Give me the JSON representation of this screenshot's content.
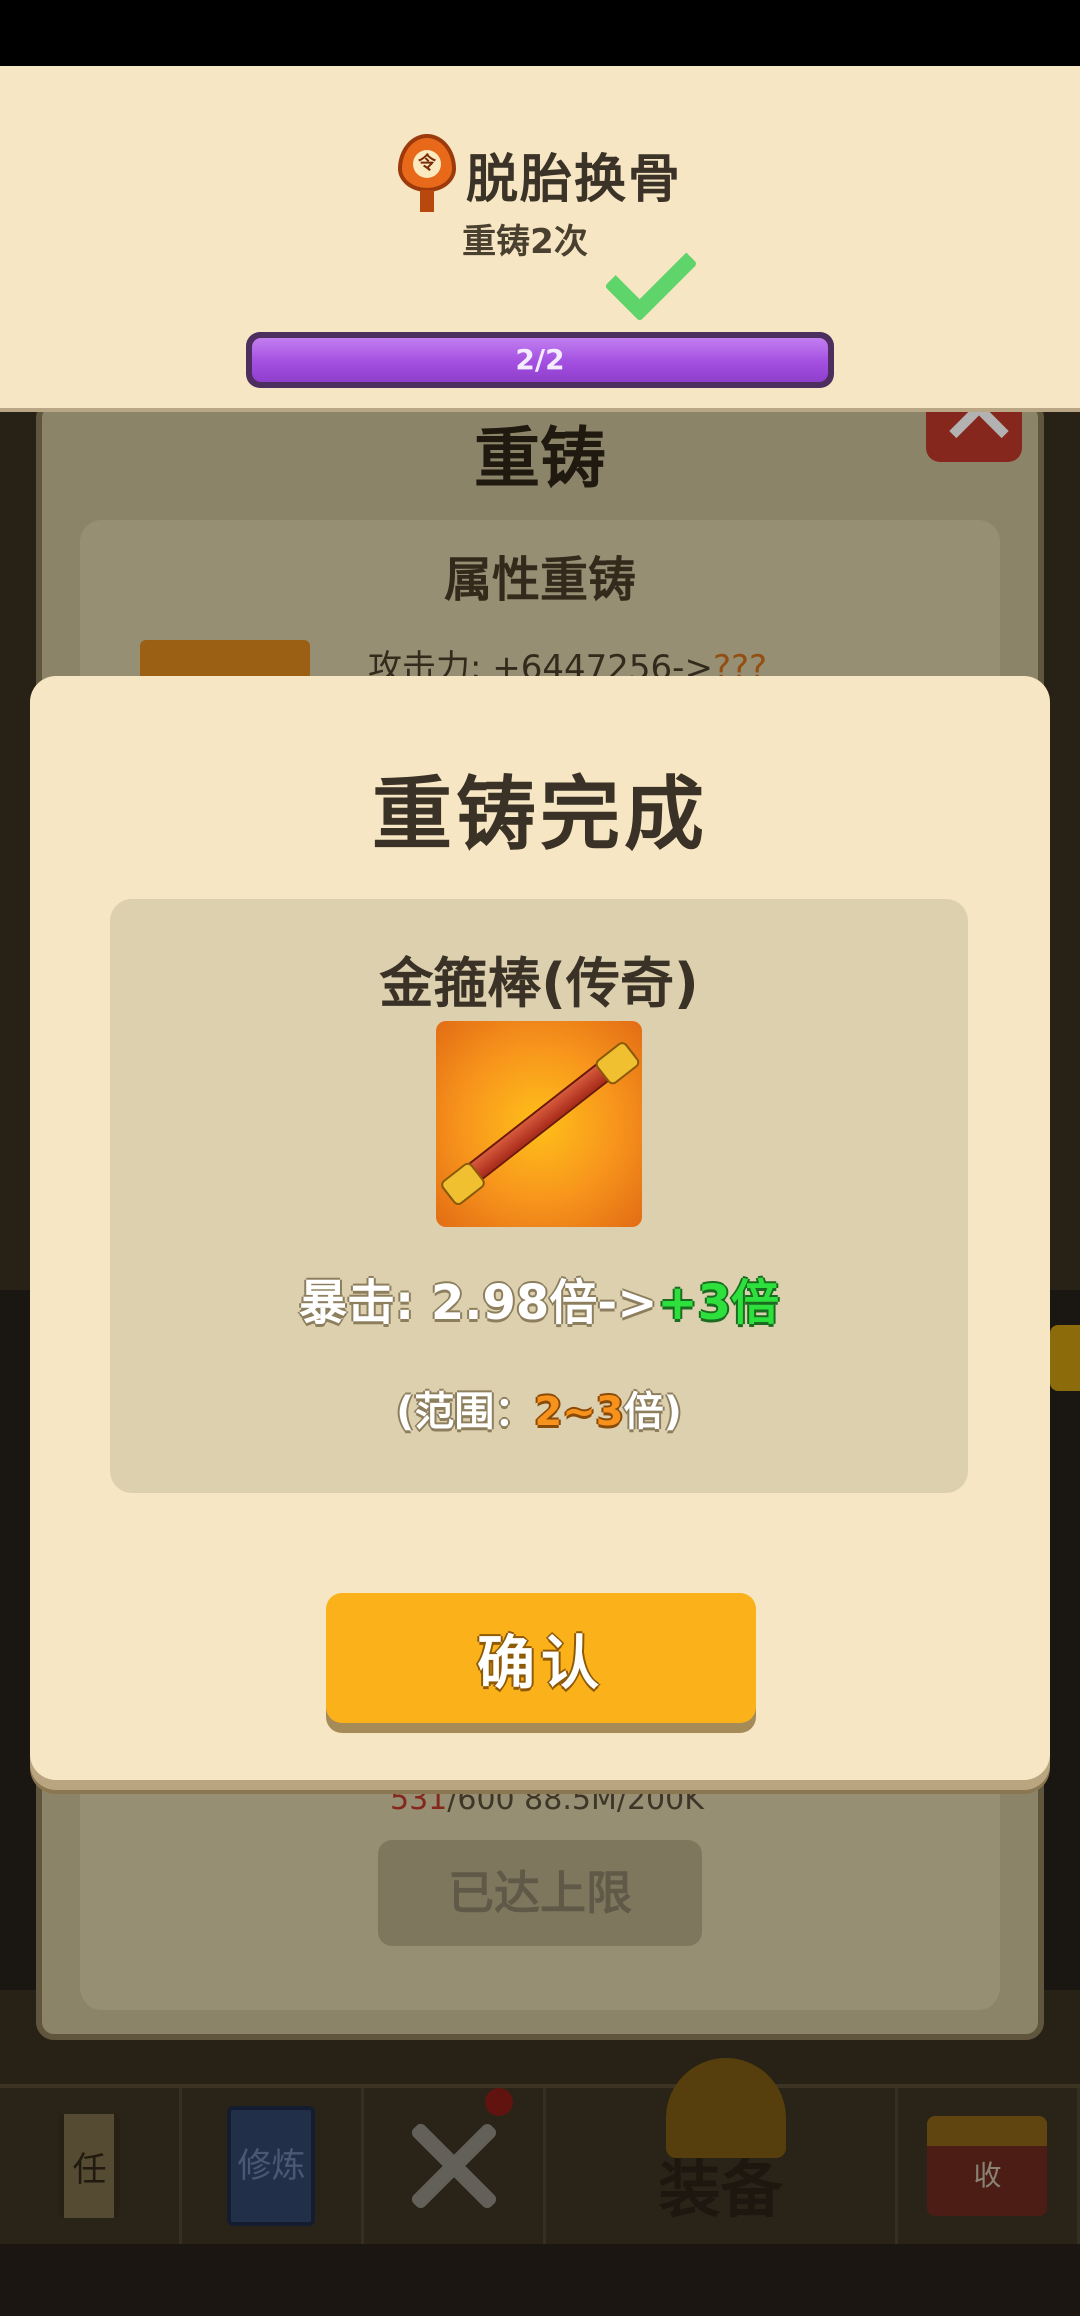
{
  "background": {
    "panel_title": "重铸",
    "section_title": "属性重铸",
    "attr_line_prefix": "攻击力: +6447256->",
    "attr_line_unknown": "???",
    "counter_current": "531",
    "counter_rest": "/600  88.5M/200K",
    "max_button_label": "已达上限"
  },
  "bottom_nav": {
    "items": [
      {
        "icon": "scroll-icon",
        "text": "任"
      },
      {
        "icon": "book-icon",
        "text": "修炼"
      },
      {
        "icon": "crossed-swords-icon"
      },
      {
        "icon": "helmet-icon",
        "label": "装备"
      },
      {
        "icon": "shop-icon",
        "text": "收"
      }
    ]
  },
  "achievement": {
    "icon": "flame-token-icon",
    "icon_text": "令",
    "title": "脱胎换骨",
    "subtitle": "重铸2次",
    "progress": 1.0,
    "progress_text": "2/2",
    "completed_icon": "checkmark-icon"
  },
  "modal": {
    "title": "重铸完成",
    "item_name": "金箍棒(传奇)",
    "item_icon": "golden-staff-icon",
    "stat_prefix": "暴击: 2.98倍->",
    "stat_new": "+3倍",
    "range_prefix": "(范围：",
    "range_low": "2",
    "range_sep": "~",
    "range_high": "3",
    "range_suffix": "倍)",
    "confirm_label": "确认"
  },
  "colors": {
    "panel": "#f7e6c3",
    "card": "#ddd0ae",
    "confirm": "#fbb21a",
    "progress": "#a34fe0",
    "stat_new": "#2ee03c",
    "range_num": "#f7931c"
  }
}
